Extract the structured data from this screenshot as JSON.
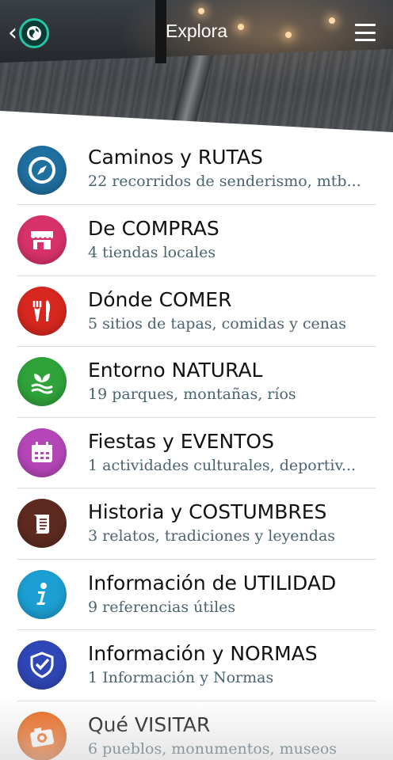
{
  "header": {
    "title": "Explora",
    "back_icon": "chevron-left-icon",
    "logo_icon": "globe-icon",
    "menu_icon": "hamburger-menu-icon",
    "accent": "#24c6a8"
  },
  "items": [
    {
      "title": "Caminos y RUTAS",
      "subtitle": "22 recorridos de senderismo, mtb...",
      "icon": "compass-icon",
      "color": "#1f6f9f"
    },
    {
      "title": "De COMPRAS",
      "subtitle": "4 tiendas locales",
      "icon": "shop-icon",
      "color": "#d8326a"
    },
    {
      "title": "Dónde COMER",
      "subtitle": "5 sitios de tapas, comidas y cenas",
      "icon": "fork-knife-icon",
      "color": "#d8271f"
    },
    {
      "title": "Entorno NATURAL",
      "subtitle": "19 parques, montañas, ríos",
      "icon": "leaf-icon",
      "color": "#2fa33a"
    },
    {
      "title": "Fiestas y EVENTOS",
      "subtitle": "1 actividades culturales, deportiv...",
      "icon": "calendar-icon",
      "color": "#b546b8"
    },
    {
      "title": "Historia y COSTUMBRES",
      "subtitle": "3 relatos, tradiciones y leyendas",
      "icon": "scroll-icon",
      "color": "#5e2a20"
    },
    {
      "title": "Información de UTILIDAD",
      "subtitle": "9 referencias útiles",
      "icon": "info-icon",
      "color": "#1c9fd2"
    },
    {
      "title": "Información y NORMAS",
      "subtitle": "1 Información y Normas",
      "icon": "shield-check-icon",
      "color": "#2f47b6"
    },
    {
      "title": "Qué VISITAR",
      "subtitle": "6 pueblos, monumentos, museos",
      "icon": "camera-icon",
      "color": "#ec6a1f"
    }
  ]
}
